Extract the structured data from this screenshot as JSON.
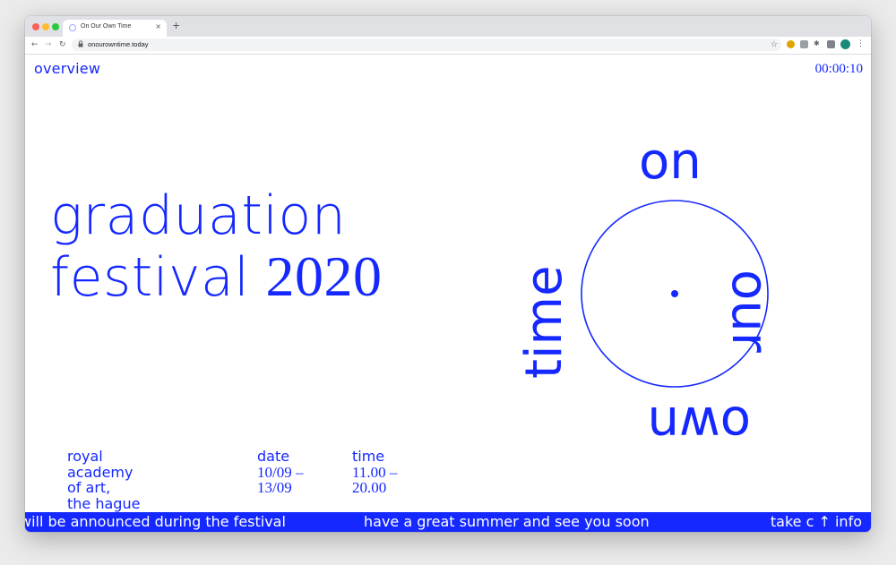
{
  "browser": {
    "tab_title": "On Our Own Time",
    "tab_close": "×",
    "new_tab": "+",
    "url": "onourowntime.today",
    "icons": {
      "back": "←",
      "forward": "→",
      "reload": "↻",
      "lock": "🔒",
      "star": "☆",
      "puzzle": "✱",
      "menu": "⋮"
    }
  },
  "page": {
    "overview_label": "overview",
    "timer": "00:00:10",
    "headline": {
      "line1": "graduation",
      "line2": "festival",
      "year": "2020"
    },
    "logo": {
      "top": "on",
      "right": "our",
      "bottom": "own",
      "left": "time"
    },
    "info": {
      "venue": [
        "royal",
        "academy",
        "of art,",
        "the hague"
      ],
      "date_label": "date",
      "date_values": [
        "10/09 –",
        "13/09"
      ],
      "time_label": "time",
      "time_values": [
        "11.00 –",
        "20.00"
      ]
    },
    "ticker": {
      "part1": "will be announced during the festival",
      "part2": "have a great summer and see you soon",
      "part3": "take c ↑ info"
    }
  },
  "colors": {
    "accent": "#1428ff",
    "background": "#ffffff"
  }
}
